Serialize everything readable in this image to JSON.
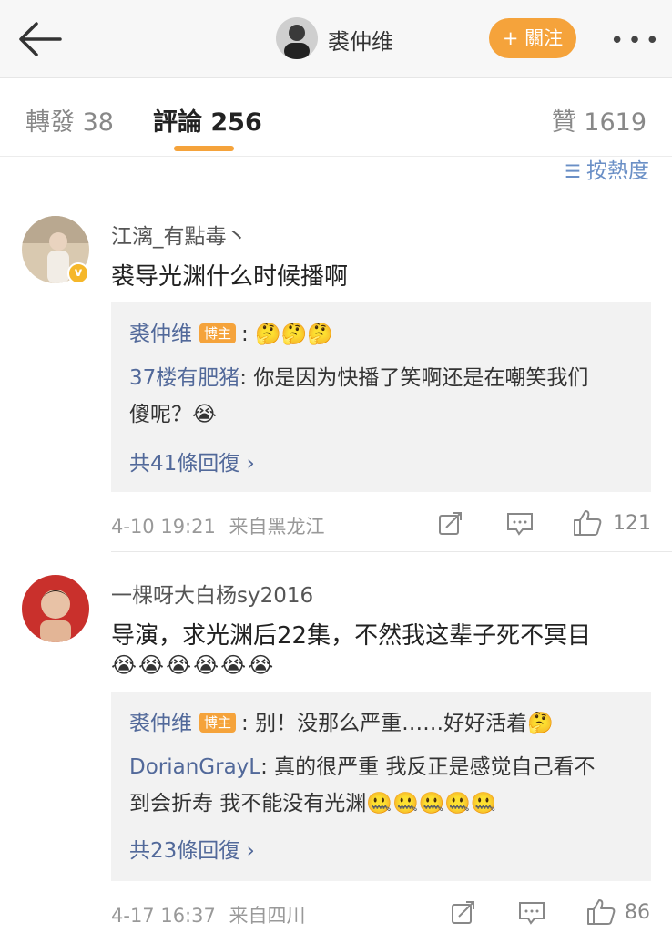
{
  "header": {
    "name": "裘仲维",
    "follow_label": "+ 關注",
    "more_label": "•••"
  },
  "tabs": {
    "repost": "轉發 38",
    "comment": "評論 256",
    "like": "贊 1619"
  },
  "sort": {
    "label": "按熱度"
  },
  "comments": [
    {
      "username": "江漓_有點毒丶",
      "text": "裘导光渊什么时候播啊",
      "replies": [
        {
          "name": "裘仲维",
          "tag": "博主",
          "text": ": 🤔🤔🤔"
        },
        {
          "name": "37楼有肥猪",
          "text": ": 你是因为快播了笑啊还是在嘲笑我们"
        },
        {
          "text": "傻呢？😭"
        }
      ],
      "more_replies": "共41條回復 ›",
      "time": "4-10 19:21",
      "source": "来自黑龙江",
      "likes": "121"
    },
    {
      "username": "一棵呀大白杨sy2016",
      "text": "导演，求光渊后22集，不然我这辈子死不冥目",
      "emojis": "😭😭😭😭😭😭",
      "replies": [
        {
          "name": "裘仲维",
          "tag": "博主",
          "text": ": 别！没那么严重……好好活着🤔"
        },
        {
          "name": "DorianGrayL",
          "text": ": 真的很严重  我反正是感觉自己看不"
        },
        {
          "text": "到会折寿  我不能没有光渊🤐🤐🤐🤐🤐"
        }
      ],
      "more_replies": "共23條回復 ›",
      "time": "4-17 16:37",
      "source": "来自四川",
      "likes": "86"
    }
  ],
  "colors": {
    "accent": "#f5a33b",
    "link": "#52699a"
  }
}
